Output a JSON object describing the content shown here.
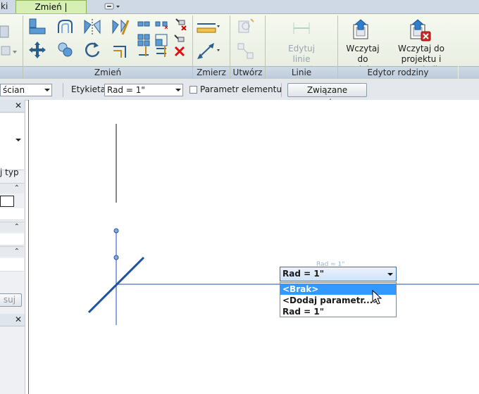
{
  "tabs": {
    "left_partial": "ki",
    "active": "Zmień | Wymiary",
    "dropdown_icon": "ribbon-minimize-icon"
  },
  "ribbon": {
    "panels": {
      "modify": "Zmień",
      "measure": "Zmierz",
      "create": "Utwórz",
      "reference": "Linie pomocnicze",
      "family_editor": "Edytor rodziny"
    },
    "buttons": {
      "edit_reference": "Edytuj\nlinie pomocnicze",
      "load_project": "Wczytaj do\nprojektu",
      "load_close": "Wczytaj do\nprojektu i zamknij"
    }
  },
  "options_bar": {
    "left_combo_value": "ścian",
    "label_caption": "Etykieta:",
    "label_value": "Rad = 1\"",
    "param_checkbox_label": "Parametr elementu",
    "param_checked": false,
    "assoc_button": "Związane wymiary"
  },
  "left_panel": {
    "type_partial": "j typ",
    "apply_partial": "suj",
    "close_glyph": "✕",
    "expand_glyph": "⌃"
  },
  "canvas": {
    "dim_label_ghost": "Rad = 1\"",
    "dropdown": {
      "value": "Rad = 1\"",
      "options": [
        "<Brak>",
        "<Dodaj parametr...>",
        "Rad = 1\""
      ],
      "selected_index": 0
    }
  },
  "colors": {
    "accent_tab": "#d8efb4",
    "selection": "#3399ff",
    "sketch_line": "#1f4fa8"
  }
}
